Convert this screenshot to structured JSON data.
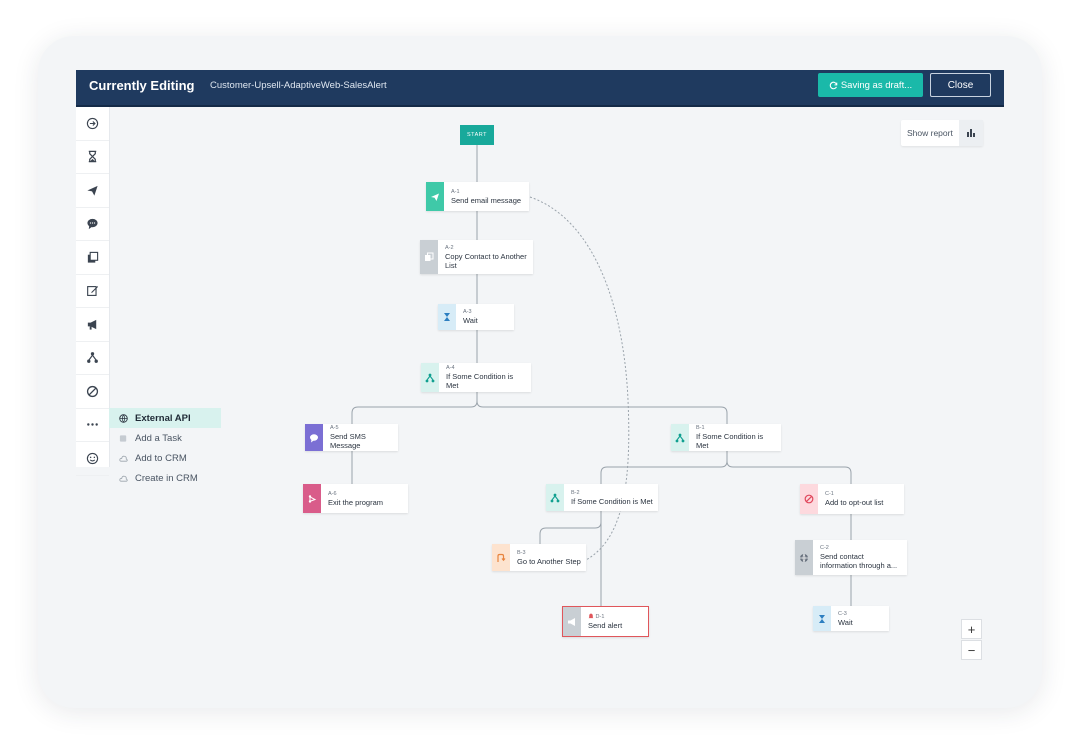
{
  "header": {
    "title": "Currently Editing",
    "workflow_name": "Customer-Upsell-AdaptiveWeb-SalesAlert",
    "saving_label": "Saving as draft...",
    "close_label": "Close"
  },
  "toolbar": {
    "tools": [
      "arrow-circle-icon",
      "hourglass-icon",
      "send-icon",
      "chat-bubble-icon",
      "copy-icon",
      "edit-icon",
      "megaphone-icon",
      "branch-icon",
      "block-icon",
      "more-icon",
      "emoji-icon"
    ]
  },
  "submenu": {
    "items": [
      "External API",
      "Add a Task",
      "Add to CRM",
      "Create in CRM"
    ]
  },
  "report": {
    "label": "Show report"
  },
  "zoom": {
    "in": "+",
    "out": "−"
  },
  "flow": {
    "start": "START",
    "nodes": {
      "a1": {
        "id": "A-1",
        "label": "Send email message",
        "label2": ""
      },
      "a2": {
        "id": "A-2",
        "label": "Copy Contact to Another",
        "label2": "List"
      },
      "a3": {
        "id": "A-3",
        "label": "Wait",
        "label2": ""
      },
      "a4": {
        "id": "A-4",
        "label": "If Some Condition is Met",
        "label2": ""
      },
      "a5": {
        "id": "A-5",
        "label": "Send SMS Message",
        "label2": ""
      },
      "a6": {
        "id": "A-6",
        "label": "Exit the program",
        "label2": ""
      },
      "b1": {
        "id": "B-1",
        "label": "If Some Condition is Met",
        "label2": ""
      },
      "b2": {
        "id": "B-2",
        "label": "If Some Condition is Met",
        "label2": ""
      },
      "b3": {
        "id": "B-3",
        "label": "Go to Another Step",
        "label2": ""
      },
      "d1": {
        "id": "D-1",
        "label": "Send alert",
        "label2": ""
      },
      "c1": {
        "id": "C-1",
        "label": "Add to opt-out list",
        "label2": ""
      },
      "c2": {
        "id": "C-2",
        "label": "Send contact",
        "label2": "information through a..."
      },
      "c3": {
        "id": "C-3",
        "label": "Wait",
        "label2": ""
      }
    }
  },
  "colors": {
    "header_bg": "#1f3a5f",
    "accent_teal": "#1ab9a9",
    "email": "#3fc9a8",
    "gray": "#c9cfd4",
    "wait": "#4aa3d8",
    "condition": "#1ab9a9",
    "sms": "#7b6fd4",
    "exit": "#d95c8a",
    "goto": "#f2a66b",
    "alert": "#e0565b",
    "optout": "#f36c7c"
  }
}
